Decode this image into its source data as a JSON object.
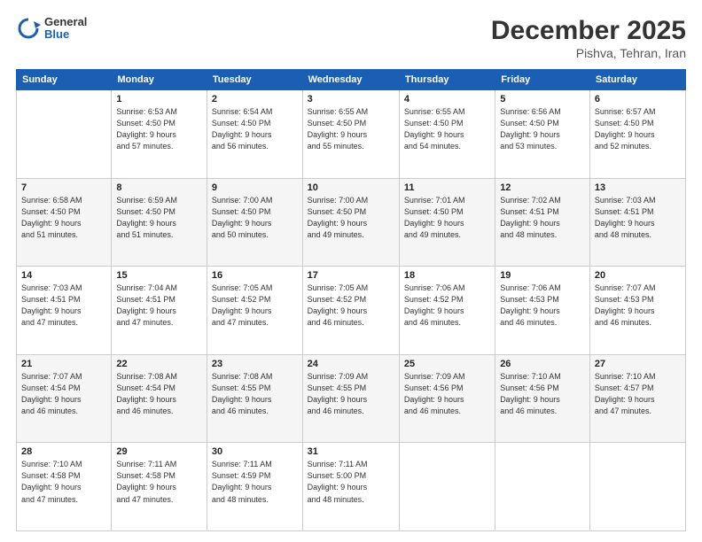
{
  "header": {
    "logo_general": "General",
    "logo_blue": "Blue",
    "month_title": "December 2025",
    "location": "Pishva, Tehran, Iran"
  },
  "columns": [
    "Sunday",
    "Monday",
    "Tuesday",
    "Wednesday",
    "Thursday",
    "Friday",
    "Saturday"
  ],
  "weeks": [
    [
      {
        "day": "",
        "info": ""
      },
      {
        "day": "1",
        "info": "Sunrise: 6:53 AM\nSunset: 4:50 PM\nDaylight: 9 hours\nand 57 minutes."
      },
      {
        "day": "2",
        "info": "Sunrise: 6:54 AM\nSunset: 4:50 PM\nDaylight: 9 hours\nand 56 minutes."
      },
      {
        "day": "3",
        "info": "Sunrise: 6:55 AM\nSunset: 4:50 PM\nDaylight: 9 hours\nand 55 minutes."
      },
      {
        "day": "4",
        "info": "Sunrise: 6:55 AM\nSunset: 4:50 PM\nDaylight: 9 hours\nand 54 minutes."
      },
      {
        "day": "5",
        "info": "Sunrise: 6:56 AM\nSunset: 4:50 PM\nDaylight: 9 hours\nand 53 minutes."
      },
      {
        "day": "6",
        "info": "Sunrise: 6:57 AM\nSunset: 4:50 PM\nDaylight: 9 hours\nand 52 minutes."
      }
    ],
    [
      {
        "day": "7",
        "info": "Sunrise: 6:58 AM\nSunset: 4:50 PM\nDaylight: 9 hours\nand 51 minutes."
      },
      {
        "day": "8",
        "info": "Sunrise: 6:59 AM\nSunset: 4:50 PM\nDaylight: 9 hours\nand 51 minutes."
      },
      {
        "day": "9",
        "info": "Sunrise: 7:00 AM\nSunset: 4:50 PM\nDaylight: 9 hours\nand 50 minutes."
      },
      {
        "day": "10",
        "info": "Sunrise: 7:00 AM\nSunset: 4:50 PM\nDaylight: 9 hours\nand 49 minutes."
      },
      {
        "day": "11",
        "info": "Sunrise: 7:01 AM\nSunset: 4:50 PM\nDaylight: 9 hours\nand 49 minutes."
      },
      {
        "day": "12",
        "info": "Sunrise: 7:02 AM\nSunset: 4:51 PM\nDaylight: 9 hours\nand 48 minutes."
      },
      {
        "day": "13",
        "info": "Sunrise: 7:03 AM\nSunset: 4:51 PM\nDaylight: 9 hours\nand 48 minutes."
      }
    ],
    [
      {
        "day": "14",
        "info": "Sunrise: 7:03 AM\nSunset: 4:51 PM\nDaylight: 9 hours\nand 47 minutes."
      },
      {
        "day": "15",
        "info": "Sunrise: 7:04 AM\nSunset: 4:51 PM\nDaylight: 9 hours\nand 47 minutes."
      },
      {
        "day": "16",
        "info": "Sunrise: 7:05 AM\nSunset: 4:52 PM\nDaylight: 9 hours\nand 47 minutes."
      },
      {
        "day": "17",
        "info": "Sunrise: 7:05 AM\nSunset: 4:52 PM\nDaylight: 9 hours\nand 46 minutes."
      },
      {
        "day": "18",
        "info": "Sunrise: 7:06 AM\nSunset: 4:52 PM\nDaylight: 9 hours\nand 46 minutes."
      },
      {
        "day": "19",
        "info": "Sunrise: 7:06 AM\nSunset: 4:53 PM\nDaylight: 9 hours\nand 46 minutes."
      },
      {
        "day": "20",
        "info": "Sunrise: 7:07 AM\nSunset: 4:53 PM\nDaylight: 9 hours\nand 46 minutes."
      }
    ],
    [
      {
        "day": "21",
        "info": "Sunrise: 7:07 AM\nSunset: 4:54 PM\nDaylight: 9 hours\nand 46 minutes."
      },
      {
        "day": "22",
        "info": "Sunrise: 7:08 AM\nSunset: 4:54 PM\nDaylight: 9 hours\nand 46 minutes."
      },
      {
        "day": "23",
        "info": "Sunrise: 7:08 AM\nSunset: 4:55 PM\nDaylight: 9 hours\nand 46 minutes."
      },
      {
        "day": "24",
        "info": "Sunrise: 7:09 AM\nSunset: 4:55 PM\nDaylight: 9 hours\nand 46 minutes."
      },
      {
        "day": "25",
        "info": "Sunrise: 7:09 AM\nSunset: 4:56 PM\nDaylight: 9 hours\nand 46 minutes."
      },
      {
        "day": "26",
        "info": "Sunrise: 7:10 AM\nSunset: 4:56 PM\nDaylight: 9 hours\nand 46 minutes."
      },
      {
        "day": "27",
        "info": "Sunrise: 7:10 AM\nSunset: 4:57 PM\nDaylight: 9 hours\nand 47 minutes."
      }
    ],
    [
      {
        "day": "28",
        "info": "Sunrise: 7:10 AM\nSunset: 4:58 PM\nDaylight: 9 hours\nand 47 minutes."
      },
      {
        "day": "29",
        "info": "Sunrise: 7:11 AM\nSunset: 4:58 PM\nDaylight: 9 hours\nand 47 minutes."
      },
      {
        "day": "30",
        "info": "Sunrise: 7:11 AM\nSunset: 4:59 PM\nDaylight: 9 hours\nand 48 minutes."
      },
      {
        "day": "31",
        "info": "Sunrise: 7:11 AM\nSunset: 5:00 PM\nDaylight: 9 hours\nand 48 minutes."
      },
      {
        "day": "",
        "info": ""
      },
      {
        "day": "",
        "info": ""
      },
      {
        "day": "",
        "info": ""
      }
    ]
  ]
}
